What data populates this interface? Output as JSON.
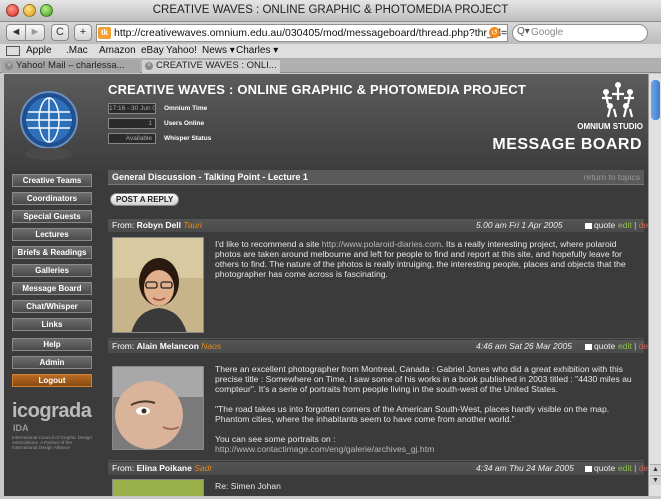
{
  "window": {
    "title": "CREATIVE WAVES : ONLINE GRAPHIC & PHOTOMEDIA PROJECT"
  },
  "toolbar": {
    "back_label": "◄",
    "forward_label": "►",
    "reload_label": "C",
    "add_label": "+",
    "url": "http://creativewaves.omnium.edu.au/030405/mod/messageboard/thread.php?thr_id=31",
    "search_placeholder": "Google"
  },
  "bookmarks": [
    "Apple",
    ".Mac",
    "Amazon",
    "eBay",
    "Yahoo!",
    "News ▾",
    "Charles ▾"
  ],
  "tabs": [
    {
      "label": "Yahoo! Mail – charlessa..."
    },
    {
      "label": "CREATIVE WAVES : ONLI..."
    }
  ],
  "header": {
    "site_title": "CREATIVE WAVES : ONLINE GRAPHIC & PHOTOMEDIA PROJECT",
    "time_value": "17:16 - 30 Jun 05",
    "time_label": "Omnium Time",
    "users_value": "1",
    "users_label": "Users Online",
    "whisper_value": "Available",
    "whisper_label": "Whisper Status",
    "studio_label": "OMNIUM STUDIO",
    "board_title": "MESSAGE BOARD"
  },
  "sidebar": {
    "items": [
      {
        "label": "Creative Teams"
      },
      {
        "label": "Coordinators"
      },
      {
        "label": "Special Guests"
      },
      {
        "label": "Lectures"
      },
      {
        "label": "Briefs & Readings"
      },
      {
        "label": "Galleries"
      },
      {
        "label": "Message Board"
      },
      {
        "label": "Chat/Whisper"
      },
      {
        "label": "Links"
      },
      {
        "label": "Help"
      },
      {
        "label": "Admin"
      },
      {
        "label": "Logout"
      }
    ],
    "logo_text": "icograda",
    "logo_sub": "IDA",
    "logo_caption": "International Council of Graphic Design Associations. A Partner of the International Design Alliance"
  },
  "thread": {
    "title": "General Discussion - Talking Point - Lecture 1",
    "return_label": "return to topics",
    "reply_label": "POST A REPLY"
  },
  "posts": [
    {
      "from_label": "From:",
      "author": "Robyn Dell",
      "location": "Tauri",
      "date": "5.00 am Fri 1 Apr 2005",
      "quote_label": "quote",
      "edit_label": "edit",
      "delete_label": "delete",
      "text1": "I'd like to recommend a site ",
      "link": "http://www.polaroid-diaries.com",
      "text2": ". Its a really interesting project, where polaroid photos are taken around melbourne and left for people to find and report at this site, and hopefully leave for others to find. The nature of the photos is really intruiging, the interesting people, places and objects that the photographer has come across is fascinating."
    },
    {
      "from_label": "From:",
      "author": "Alain Melancon",
      "location": "Naos",
      "date": "4:46 am Sat 26 Mar 2005",
      "quote_label": "quote",
      "edit_label": "edit",
      "delete_label": "delete",
      "para1": "There an excellent photographer from Montreal, Canada : Gabriel Jones who did a great exhibition with this precise title : Somewhere on Time. I saw some of his works in a book published in 2003 titled : \"4430 miles au compteur\". It's a serie of portraits from people living in the south-west of the United States.",
      "para2": "\"The road takes us into forgotten corners of the American South-West, places hardly visible on the map. Phantom cities, where the inhabitants seem to have come from another world.\"",
      "para3": "You can see some portraits on :",
      "link": "http://www.contactimage.com/eng/galerie/archives_gj.htm"
    },
    {
      "from_label": "From:",
      "author": "Elina Poikane",
      "location": "Sadr",
      "date": "4:34 am Thu 24 Mar 2005",
      "quote_label": "quote",
      "edit_label": "edit",
      "delete_label": "delete",
      "text": "Re: Simen Johan"
    }
  ],
  "colors": {
    "accent_orange": "#e08a1a",
    "edit_green": "#8cc04a",
    "delete_red": "#cc6655",
    "page_bg": "#3b3b3b"
  }
}
